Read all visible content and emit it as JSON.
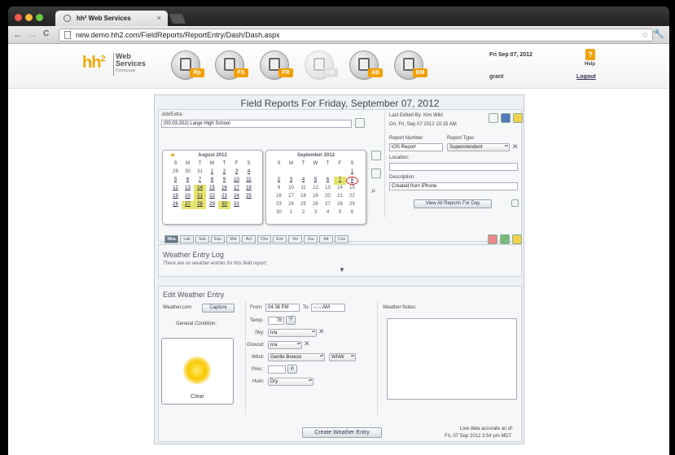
{
  "browser": {
    "tab_title": "hh² Web Services",
    "tab_close": "×",
    "back": "←",
    "forward": "→",
    "reload": "C",
    "url": "new.demo.hh2.com/FieldReports/ReportEntry/Dash/Dash.aspx",
    "star": "☆",
    "wrench": "🔧"
  },
  "header": {
    "logo_hh": "hh",
    "logo_sup": "2",
    "logo_line1": "Web",
    "logo_line2": "Services",
    "logo_sub": "Homepage",
    "modules": [
      {
        "badge": "Rp",
        "enabled": true
      },
      {
        "badge": "FS",
        "enabled": true
      },
      {
        "badge": "FR",
        "enabled": true
      },
      {
        "badge": "HR",
        "enabled": false
      },
      {
        "badge": "AB",
        "enabled": true
      },
      {
        "badge": "BM",
        "enabled": true
      }
    ],
    "date": "Fri Sep 07, 2012",
    "user": "grant",
    "help_icon": "?",
    "help": "Help",
    "logout": "Logout"
  },
  "page": {
    "title": "Field Reports For Friday, September 07, 2012"
  },
  "job": {
    "label": "Job/Extra:",
    "value": "(00.03.202) Large High School"
  },
  "meta": {
    "last_edited": "Last Edited By: Kim Wild",
    "on": "On: Fri, Sep 07 2012 10:15 AM"
  },
  "report": {
    "number_label": "Report Number:",
    "number_value": "iOS Report",
    "type_label": "Report Type:",
    "type_value": "Superintendent",
    "location_label": "Location:",
    "location_value": "",
    "description_label": "Description:",
    "description_value": "Created from iPhone.",
    "view_all": "View All Reports For Day"
  },
  "calendar_aug": {
    "prev": "◀",
    "title": "August 2012",
    "headers": [
      "S",
      "M",
      "T",
      "W",
      "T",
      "F",
      "S"
    ],
    "days": [
      "29",
      "30",
      "31",
      "1",
      "2",
      "3",
      "4",
      "5",
      "6",
      "7",
      "8",
      "9",
      "10",
      "11",
      "12",
      "13",
      "14",
      "15",
      "16",
      "17",
      "18",
      "19",
      "20",
      "21",
      "22",
      "23",
      "24",
      "25",
      "26",
      "27",
      "28",
      "29",
      "30",
      "31",
      ""
    ]
  },
  "calendar_sep": {
    "title": "September 2012",
    "headers": [
      "S",
      "M",
      "T",
      "W",
      "T",
      "F",
      "S"
    ],
    "days": [
      "",
      "",
      "",
      "",
      "",
      "",
      "1",
      "2",
      "3",
      "4",
      "5",
      "6",
      "7",
      "8",
      "9",
      "10",
      "11",
      "12",
      "13",
      "14",
      "15",
      "16",
      "17",
      "18",
      "19",
      "20",
      "21",
      "22",
      "23",
      "24",
      "25",
      "26",
      "27",
      "28",
      "29",
      "30",
      "1",
      "2",
      "3",
      "4",
      "5",
      "6"
    ]
  },
  "tabs": [
    "Wea",
    "Lab",
    "Sub",
    "Equ",
    "Mat",
    "Act",
    "Cha",
    "Eve",
    "Vis",
    "Jou",
    "Att",
    "Cus"
  ],
  "log": {
    "title": "Weather Entry Log",
    "empty": "There are no weather entries for this field report.",
    "toggle": "▼"
  },
  "edit": {
    "title": "Edit Weather Entry",
    "weathercom": "Weather.com",
    "capture": "Capture",
    "general_condition": "General Condition:",
    "condition": "Clear",
    "from_label": "From:",
    "from_value": "04:36 PM",
    "to_label": "To:",
    "to_value": "--:-- AM",
    "temp_label": "Temp:",
    "temp_value": "78",
    "temp_unit": "°F",
    "sky_label": "Sky:",
    "sky_value": "n/a",
    "ground_label": "Ground:",
    "ground_value": "n/a",
    "wind_label": "Wind:",
    "wind_value": "Gentle Breeze",
    "wind_dir": "WNW",
    "prec_label": "Prec:",
    "prec_value": "",
    "prec_unit": "in",
    "hum_label": "Hum:",
    "hum_value": "Dry",
    "notes_label": "Weather Notes:",
    "create": "Create Weather Entry",
    "live_line1": "Live data accurate as of:",
    "live_line2": "Fri, 07 Sep 2012 3:54 pm MDT"
  }
}
